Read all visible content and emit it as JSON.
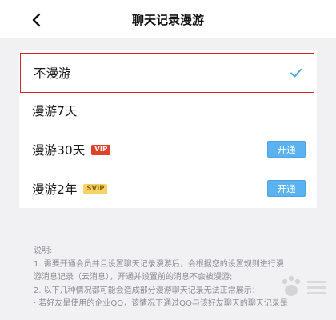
{
  "header": {
    "title": "聊天记录漫游"
  },
  "options": [
    {
      "label": "不漫游",
      "selected": true
    },
    {
      "label": "漫游7天",
      "selected": false
    },
    {
      "label": "漫游30天",
      "badge": "VIP",
      "button": "开通",
      "selected": false
    },
    {
      "label": "漫游2年",
      "badge": "SVIP",
      "button": "开通",
      "selected": false
    }
  ],
  "notes": {
    "title": "说明:",
    "line1": "1. 需要开通会员并且设置聊天记录漫游后，会根据您的设置规则进行漫",
    "line2": "游消息记录（云消息），开通并设置前的消息不会被漫游;",
    "line3": "2. 以下几种情况都可能会造成部分漫游聊天记录无法正常展示：",
    "line4": "· 若好友是使用的企业QQ，该情况下通过QQ与该好友聊天的聊天记录是"
  },
  "colors": {
    "accent": "#5ab3f0",
    "selection_outline": "#d8232a",
    "check": "#4aa4e2",
    "vip_badge": "#e0412b",
    "svip_badge": "#f5d267"
  },
  "icons": {
    "back": "chevron-left-icon",
    "check": "check-icon",
    "watermark": "paw-icon"
  }
}
